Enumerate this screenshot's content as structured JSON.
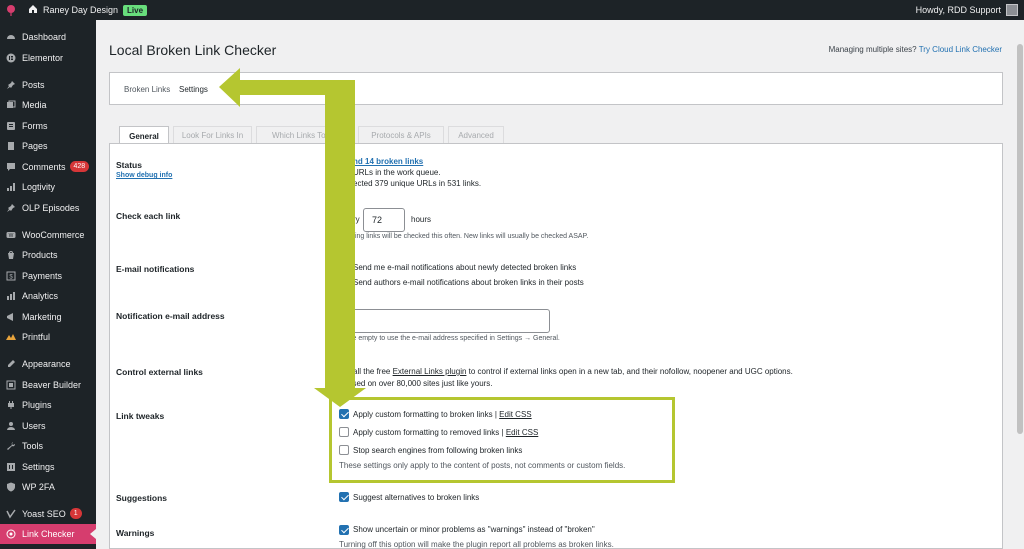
{
  "adminbar": {
    "site_name": "Raney Day Design",
    "live_badge": "Live",
    "greeting": "Howdy, RDD Support"
  },
  "sidebar": {
    "items": [
      {
        "label": "Dashboard",
        "icon": "dashboard-icon"
      },
      {
        "label": "Elementor",
        "icon": "elementor-icon"
      },
      {
        "label": "Posts",
        "icon": "pin-icon"
      },
      {
        "label": "Media",
        "icon": "media-icon"
      },
      {
        "label": "Forms",
        "icon": "forms-icon"
      },
      {
        "label": "Pages",
        "icon": "pages-icon"
      },
      {
        "label": "Comments",
        "icon": "comments-icon",
        "badge": "428"
      },
      {
        "label": "Logtivity",
        "icon": "logtivity-icon"
      },
      {
        "label": "OLP Episodes",
        "icon": "pin-icon"
      },
      {
        "label": "WooCommerce",
        "icon": "woocommerce-icon"
      },
      {
        "label": "Products",
        "icon": "products-icon"
      },
      {
        "label": "Payments",
        "icon": "payments-icon"
      },
      {
        "label": "Analytics",
        "icon": "analytics-icon"
      },
      {
        "label": "Marketing",
        "icon": "marketing-icon"
      },
      {
        "label": "Printful",
        "icon": "printful-icon"
      },
      {
        "label": "Appearance",
        "icon": "appearance-icon"
      },
      {
        "label": "Beaver Builder",
        "icon": "beaver-builder-icon"
      },
      {
        "label": "Plugins",
        "icon": "plugins-icon"
      },
      {
        "label": "Users",
        "icon": "users-icon"
      },
      {
        "label": "Tools",
        "icon": "tools-icon"
      },
      {
        "label": "Settings",
        "icon": "settings-icon"
      },
      {
        "label": "WP 2FA",
        "icon": "shield-icon"
      },
      {
        "label": "Yoast SEO",
        "icon": "yoast-icon",
        "badge": "1"
      },
      {
        "label": "Link Checker",
        "icon": "link-checker-icon"
      }
    ]
  },
  "page": {
    "title": "Local Broken Link Checker",
    "top_right_text": "Managing multiple sites?",
    "top_right_link": "Try Cloud Link Checker",
    "tabs": [
      "Broken Links",
      "Settings"
    ],
    "subtabs": [
      "General",
      "Look For Links In",
      "Which Links To Ch",
      "Protocols & APIs",
      "Advanced"
    ]
  },
  "settings": {
    "status": {
      "label": "Status",
      "debug_link": "Show debug info",
      "line1": "nd 14 broken links",
      "line2": "URLs in the work queue.",
      "line3": "ected 379 unique URLs in 531 links."
    },
    "check_each": {
      "label": "Check each link",
      "prefix": "ry",
      "value": "72",
      "unit": "hours",
      "desc": "ting links will be checked this often. New links will usually be checked ASAP."
    },
    "email_notifications": {
      "label": "E-mail notifications",
      "opt1": "Send me e-mail notifications about newly detected broken links",
      "opt2": "Send authors e-mail notifications about broken links in their posts"
    },
    "notification_email": {
      "label": "Notification e-mail address",
      "desc": "ve empty to use the e-mail address specified in Settings → General."
    },
    "external_links": {
      "label": "Control external links",
      "pre": "all the free",
      "link": "External Links plugin",
      "post": "to control if external links open in a new tab, and their nofollow, noopener and UGC options.",
      "line2": "used on over 80,000 sites just like yours."
    },
    "link_tweaks": {
      "label": "Link tweaks",
      "opt1": "Apply custom formatting to broken links |",
      "opt2": "Apply custom formatting to removed links |",
      "edit_css": "Edit CSS",
      "opt3": "Stop search engines from following broken links",
      "desc": "These settings only apply to the content of posts, not comments or custom fields."
    },
    "suggestions": {
      "label": "Suggestions",
      "opt": "Suggest alternatives to broken links"
    },
    "warnings": {
      "label": "Warnings",
      "opt": "Show uncertain or minor problems as \"warnings\" instead of \"broken\"",
      "desc": "Turning off this option will make the plugin report all problems as broken links."
    }
  },
  "colors": {
    "accent": "#2271b1",
    "active_menu": "#d63d6e",
    "annotation": "#b5c630",
    "adminbar": "#1d2327"
  }
}
